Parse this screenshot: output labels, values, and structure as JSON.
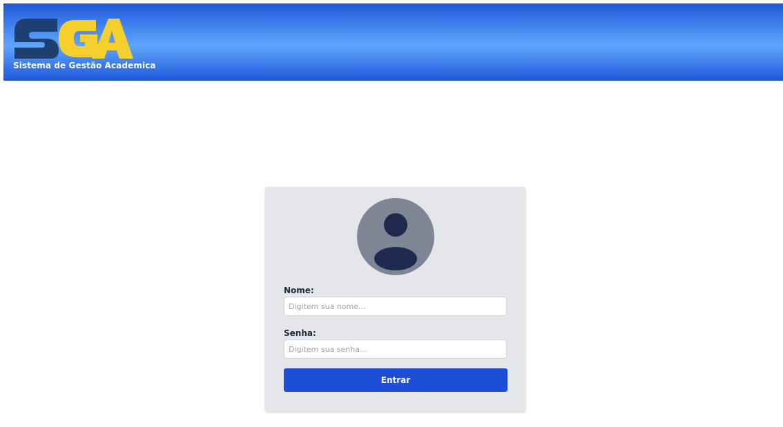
{
  "header": {
    "logo_text": "SGA",
    "subtitle": "Sistema de Gestão Academica"
  },
  "login": {
    "avatar_icon": "user-avatar-icon",
    "name_label": "Nome:",
    "name_placeholder": "Digitem sua nome...",
    "name_value": "",
    "password_label": "Senha:",
    "password_placeholder": "Digitem sua senha...",
    "password_value": "",
    "submit_label": "Entrar"
  },
  "colors": {
    "header_gradient_dark": "#1f59db",
    "header_gradient_light": "#5ea5fa",
    "logo_s": "#1d3f72",
    "logo_ga": "#f5cf2e",
    "card_background": "#e4e6ea",
    "avatar_circle": "#7e8595",
    "avatar_figure": "#1e2a4d",
    "button": "#1d4ed8"
  }
}
